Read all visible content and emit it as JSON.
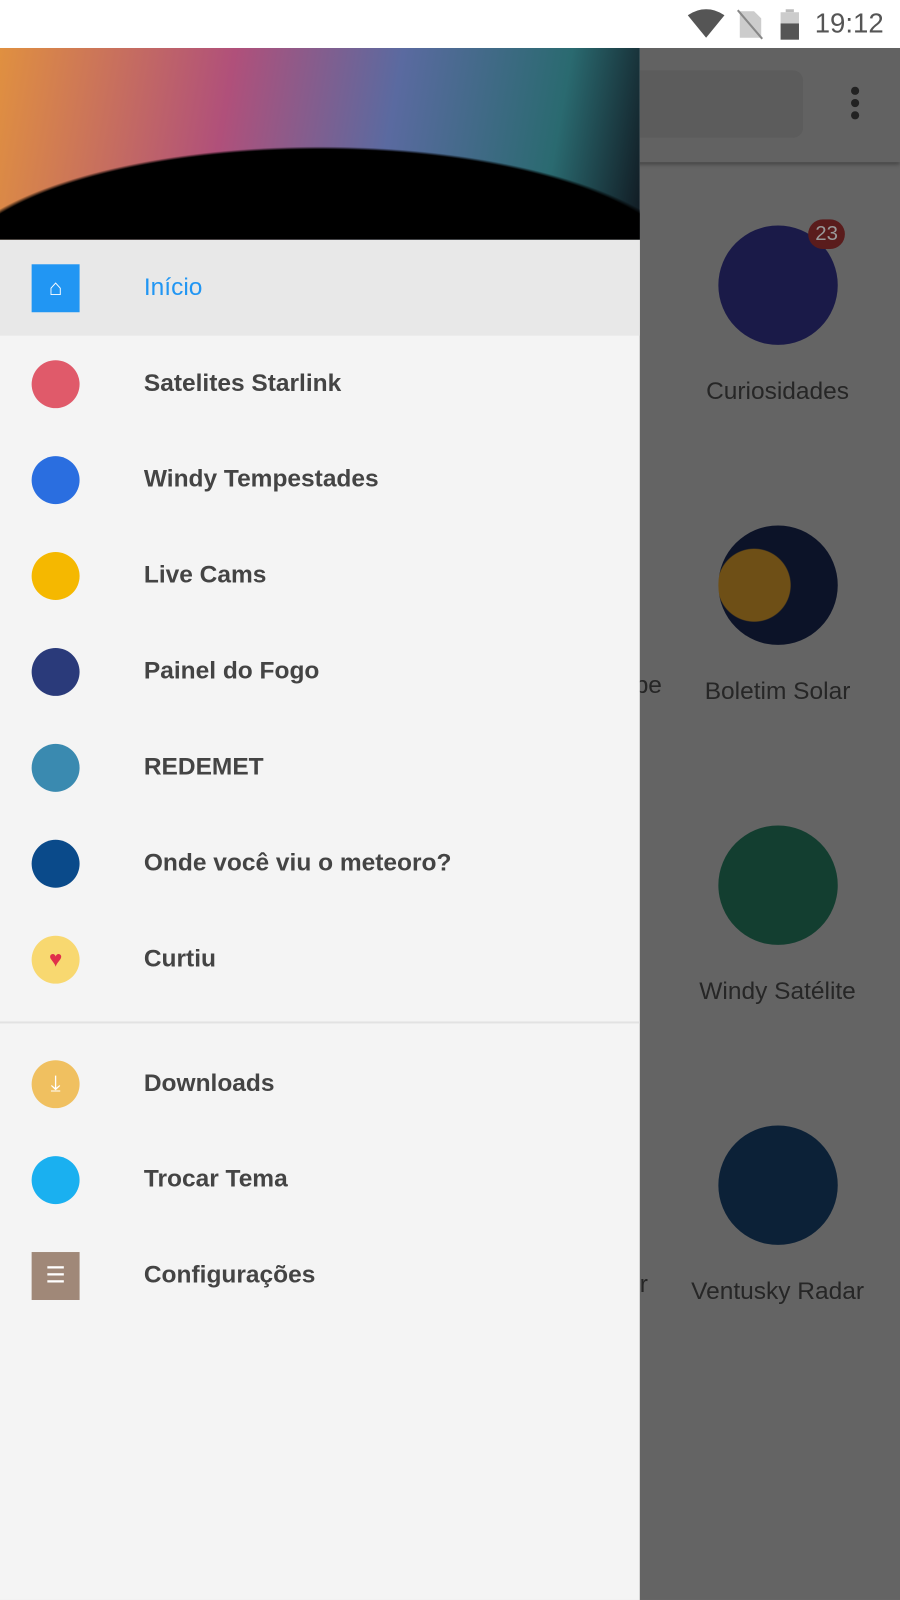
{
  "status_bar": {
    "time": "19:12",
    "icons": [
      "wifi-icon",
      "no-sim-icon",
      "battery-icon"
    ]
  },
  "background": {
    "tiles": [
      {
        "label": "Curiosidades",
        "badge": "23",
        "color": "#3a3aa0"
      },
      {
        "label": "Boletim Solar",
        "color": "#1a2a5a"
      },
      {
        "label": "Windy Satélite",
        "color": "#2a8a6a"
      },
      {
        "label": "Ventusky Radar",
        "color": "#1a4a7a"
      }
    ],
    "fragments": [
      "pe",
      "r"
    ]
  },
  "drawer": {
    "items": [
      {
        "label": "Início",
        "icon": "home-icon",
        "color": "#2196f3",
        "active": true
      },
      {
        "label": "Satelites Starlink",
        "icon": "satellite-icon",
        "color": "#e05a6a"
      },
      {
        "label": "Windy Tempestades",
        "icon": "wind-cloud-icon",
        "color": "#2a6ee0"
      },
      {
        "label": "Live Cams",
        "icon": "webcam-icon",
        "color": "#f5b800"
      },
      {
        "label": "Painel do Fogo",
        "icon": "fire-icon",
        "color": "#2a3a7a"
      },
      {
        "label": "REDEMET",
        "icon": "plane-cloud-icon",
        "color": "#3a8ab0"
      },
      {
        "label": "Onde você viu o meteoro?",
        "icon": "meteor-icon",
        "color": "#0a4a8a"
      },
      {
        "label": "Curtiu",
        "icon": "heart-icon",
        "color": "#f8d870"
      }
    ],
    "secondary": [
      {
        "label": "Downloads",
        "icon": "download-icon",
        "color": "#f0c060"
      },
      {
        "label": "Trocar Tema",
        "icon": "paint-roller-icon",
        "color": "#1ab0f0"
      },
      {
        "label": "Configurações",
        "icon": "sliders-icon",
        "color": "#a08878"
      }
    ]
  }
}
